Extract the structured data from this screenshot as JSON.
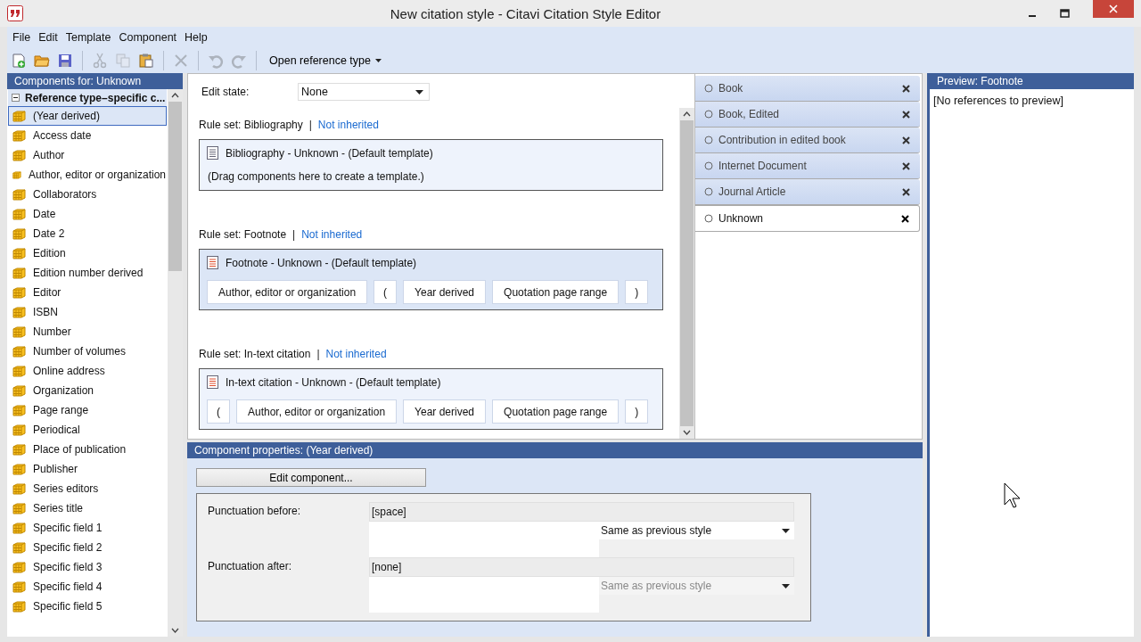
{
  "window": {
    "title": "New citation style - Citavi Citation Style Editor"
  },
  "menu": [
    "File",
    "Edit",
    "Template",
    "Component",
    "Help"
  ],
  "toolbar": {
    "tools": [
      {
        "kind": "new",
        "disabled": false
      },
      {
        "kind": "open",
        "disabled": false
      },
      {
        "kind": "save",
        "disabled": false
      },
      {
        "kind": "separator"
      },
      {
        "kind": "cut",
        "disabled": true
      },
      {
        "kind": "copy",
        "disabled": true
      },
      {
        "kind": "paste",
        "disabled": false
      },
      {
        "kind": "separator"
      },
      {
        "kind": "delete",
        "disabled": true
      },
      {
        "kind": "separator"
      },
      {
        "kind": "undo",
        "disabled": true
      },
      {
        "kind": "redo",
        "disabled": true
      },
      {
        "kind": "separator"
      }
    ],
    "dropdown": "Open reference type"
  },
  "components_panel": {
    "title": "Components for: Unknown",
    "group": {
      "label": "Reference type–specific c...",
      "expanded": true
    },
    "items": [
      {
        "label": "(Year derived)",
        "selected": true
      },
      {
        "label": "Access date",
        "selected": false
      },
      {
        "label": "Author",
        "selected": false
      },
      {
        "label": "Author, editor or organization",
        "selected": false
      },
      {
        "label": "Collaborators",
        "selected": false
      },
      {
        "label": "Date",
        "selected": false
      },
      {
        "label": "Date 2",
        "selected": false
      },
      {
        "label": "Edition",
        "selected": false
      },
      {
        "label": "Edition number derived",
        "selected": false
      },
      {
        "label": "Editor",
        "selected": false
      },
      {
        "label": "ISBN",
        "selected": false
      },
      {
        "label": "Number",
        "selected": false
      },
      {
        "label": "Number of volumes",
        "selected": false
      },
      {
        "label": "Online address",
        "selected": false
      },
      {
        "label": "Organization",
        "selected": false
      },
      {
        "label": "Page range",
        "selected": false
      },
      {
        "label": "Periodical",
        "selected": false
      },
      {
        "label": "Place of publication",
        "selected": false
      },
      {
        "label": "Publisher",
        "selected": false
      },
      {
        "label": "Series editors",
        "selected": false
      },
      {
        "label": "Series title",
        "selected": false
      },
      {
        "label": "Specific field 1",
        "selected": false
      },
      {
        "label": "Specific field 2",
        "selected": false
      },
      {
        "label": "Specific field 3",
        "selected": false
      },
      {
        "label": "Specific field 4",
        "selected": false
      },
      {
        "label": "Specific field 5",
        "selected": false
      }
    ]
  },
  "editor": {
    "edit_state": {
      "label": "Edit state:",
      "value": "None"
    },
    "rule_sets": [
      {
        "title": "Rule set: Bibliography",
        "divider": "|",
        "link": "Not inherited",
        "template": "Bibliography - Unknown - (Default template)",
        "active": false,
        "placeholder": "(Drag components here to create a template.)"
      },
      {
        "title": "Rule set: Footnote",
        "divider": "|",
        "link": "Not inherited",
        "template": "Footnote - Unknown - (Default template)",
        "active": true,
        "components": [
          "Author, editor or organization",
          "(",
          "Year derived",
          "Quotation page range",
          ")"
        ]
      },
      {
        "title": "Rule set: In-text citation",
        "divider": "|",
        "link": "Not inherited",
        "template": "In-text citation - Unknown - (Default template)",
        "active": false,
        "components": [
          "(",
          "Author, editor or organization",
          "Year derived",
          "Quotation page range",
          ")"
        ]
      }
    ]
  },
  "reference_types": [
    {
      "label": "Book",
      "selected": false
    },
    {
      "label": "Book, Edited",
      "selected": false
    },
    {
      "label": "Contribution in edited book",
      "selected": false
    },
    {
      "label": "Internet Document",
      "selected": false
    },
    {
      "label": "Journal Article",
      "selected": false
    },
    {
      "label": "Unknown",
      "selected": true
    }
  ],
  "preview": {
    "title": "Preview: Footnote",
    "text": "[No references to preview]"
  },
  "component_properties": {
    "title": "Component properties:  (Year derived)",
    "button": "Edit component...",
    "rows": [
      {
        "label": "Punctuation before:",
        "value": "[space]",
        "style": "Same as previous style",
        "disabled": false
      },
      {
        "label": "Punctuation after:",
        "value": "[none]",
        "style": "Same as previous style",
        "disabled": true
      }
    ]
  }
}
